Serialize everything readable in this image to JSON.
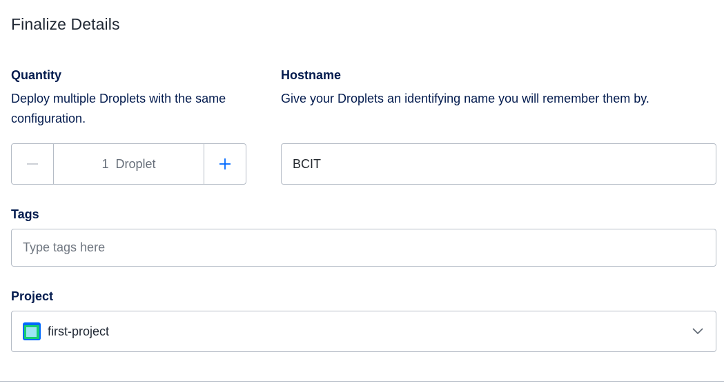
{
  "section": {
    "title": "Finalize Details"
  },
  "quantity": {
    "label": "Quantity",
    "description": "Deploy multiple Droplets with the same configuration.",
    "value": "1  Droplet",
    "minus_icon": "minus-icon",
    "plus_icon": "plus-icon"
  },
  "hostname": {
    "label": "Hostname",
    "description": "Give your Droplets an identifying name you will remember them by.",
    "value": "BCIT"
  },
  "tags": {
    "label": "Tags",
    "placeholder": "Type tags here",
    "value": ""
  },
  "project": {
    "label": "Project",
    "selected": "first-project",
    "icon": "project-icon",
    "dropdown_icon": "chevron-down-icon",
    "icon_colors": {
      "outer": "#0069ff",
      "inner": "#15cd72",
      "core": "#9ce5f4"
    }
  }
}
